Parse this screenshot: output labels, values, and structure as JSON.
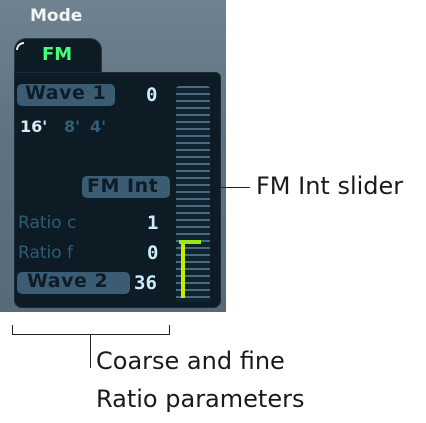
{
  "panel": {
    "mode_label": "Mode",
    "tab_label": "FM",
    "wave1_label": "Wave 1",
    "wave1_value": "0",
    "octave_16": "16'",
    "octave_8": "8'",
    "octave_4": "4'",
    "fm_int_label": "FM Int",
    "ratio_c_label": "Ratio c",
    "ratio_c_value": "1",
    "ratio_f_label": "Ratio f",
    "ratio_f_value": "0",
    "wave2_label": "Wave 2",
    "wave2_value": "36",
    "fm_int_level": 0.28
  },
  "callouts": {
    "fm_int_slider": "FM Int slider",
    "ratio_line1": "Coarse and fine",
    "ratio_line2": "Ratio parameters"
  },
  "colors": {
    "display_bg": "#0c1b24",
    "highlight": "#3b5c73",
    "tab_text": "#44ff7a",
    "slider_fill": "#c7ee00",
    "value_text": "#ccedfa"
  }
}
